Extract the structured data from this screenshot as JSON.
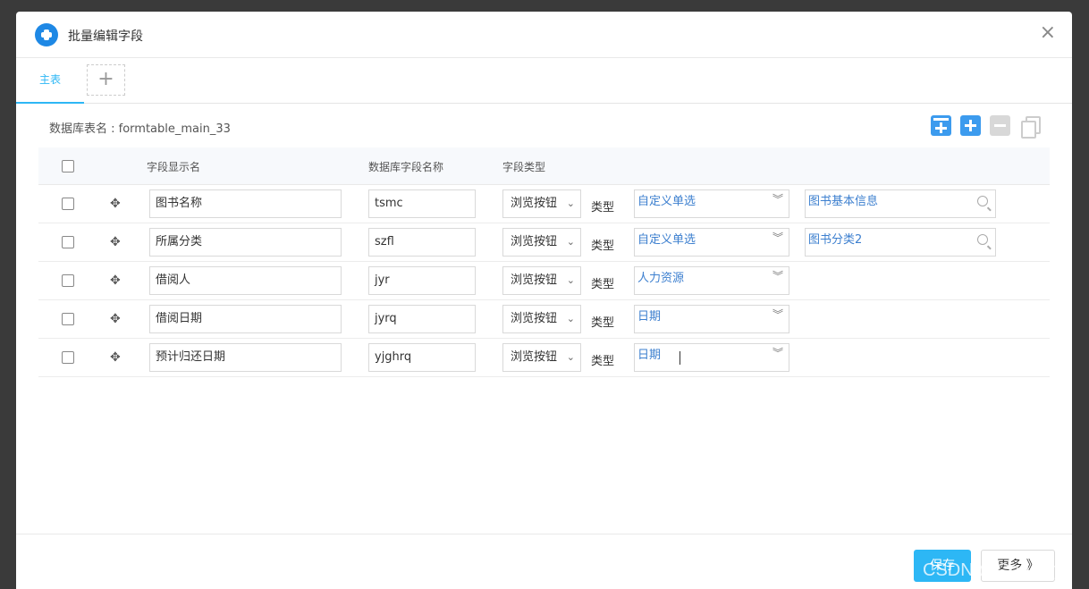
{
  "dialog": {
    "title": "批量编辑字段",
    "close_glyph": "×"
  },
  "tabs": {
    "main_label": "主表",
    "add_glyph": "+"
  },
  "info": {
    "table_name": "数据库表名 : formtable_main_33"
  },
  "toolbar": {
    "icons": [
      "batch-add-icon",
      "add-row-icon",
      "remove-row-icon",
      "copy-row-icon"
    ]
  },
  "headers": {
    "display_name": "字段显示名",
    "db_name": "数据库字段名称",
    "field_type": "字段类型"
  },
  "rows": [
    {
      "display_name": "图书名称",
      "db_name": "tsmc",
      "field_type": "浏览按钮",
      "type_label": "类型",
      "sub_type": "自定义单选",
      "browse": "图书基本信息"
    },
    {
      "display_name": "所属分类",
      "db_name": "szfl",
      "field_type": "浏览按钮",
      "type_label": "类型",
      "sub_type": "自定义单选",
      "browse": "图书分类2"
    },
    {
      "display_name": "借阅人",
      "db_name": "jyr",
      "field_type": "浏览按钮",
      "type_label": "类型",
      "sub_type": "人力资源"
    },
    {
      "display_name": "借阅日期",
      "db_name": "jyrq",
      "field_type": "浏览按钮",
      "type_label": "类型",
      "sub_type": "日期"
    },
    {
      "display_name": "预计归还日期",
      "db_name": "yjghrq",
      "field_type": "浏览按钮",
      "type_label": "类型",
      "sub_type": "日期"
    }
  ],
  "footer": {
    "save_label": "保存",
    "more_label": "更多 》"
  },
  "watermark": "CSDN @Code-zyc",
  "colors": {
    "accent": "#2db7f5",
    "icon_blue": "#3c9bee",
    "link_text": "#3c7fcf",
    "backdrop": "#3a3a3a"
  }
}
